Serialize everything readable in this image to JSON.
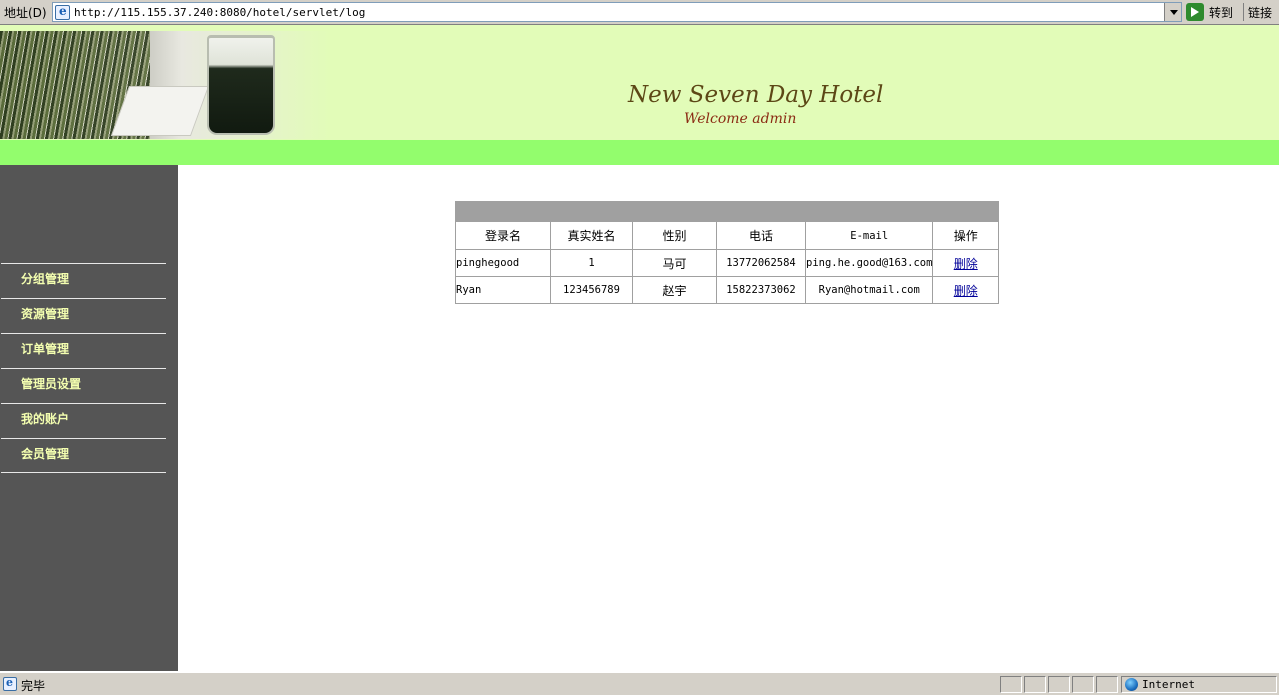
{
  "addressbar": {
    "label": "地址(D)",
    "url": "http://115.155.37.240:8080/hotel/servlet/log",
    "go_label": "转到",
    "links_label": "链接"
  },
  "banner": {
    "title": "New Seven Day Hotel",
    "welcome": "Welcome admin"
  },
  "sidebar": {
    "items": [
      {
        "label": "分组管理"
      },
      {
        "label": "资源管理"
      },
      {
        "label": "订单管理"
      },
      {
        "label": "管理员设置"
      },
      {
        "label": "我的账户"
      },
      {
        "label": "会员管理"
      }
    ]
  },
  "table": {
    "headers": [
      "登录名",
      "真实姓名",
      "性别",
      "电话",
      "E-mail",
      "操作"
    ],
    "rows": [
      {
        "login": "pinghegood",
        "realname": "1",
        "gender": "马可",
        "phone": "13772062584",
        "email": "ping.he.good@163.com",
        "action": "删除"
      },
      {
        "login": "Ryan",
        "realname": "123456789",
        "gender": "赵宇",
        "phone": "15822373062",
        "email": "Ryan@hotmail.com",
        "action": "删除"
      }
    ]
  },
  "statusbar": {
    "text": "完毕",
    "zone": "Internet"
  }
}
